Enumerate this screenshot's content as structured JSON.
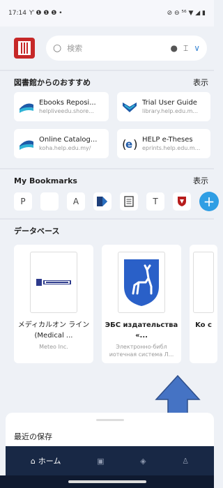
{
  "status": {
    "time": "17:14",
    "left_icons": "Ƴ ❶ ❶ ❶ •",
    "right_icons": "⊘ ⊖ ⁵⁶ ▼ ◢ ▮"
  },
  "search": {
    "placeholder": "検索"
  },
  "recommend": {
    "title": "図書館からのおすすめ",
    "more": "表示",
    "items": [
      {
        "title": "Ebooks Reposi...",
        "url": "helpliveedu.shore..."
      },
      {
        "title": "Trial User Guide",
        "url": "library.help.edu.m..."
      },
      {
        "title": "Online Catalog...",
        "url": "koha.help.edu.my/"
      },
      {
        "title": "HELP e-Theses",
        "url": "eprints.help.edu.m..."
      }
    ]
  },
  "bookmarks": {
    "title": "My Bookmarks",
    "more": "表示",
    "items": [
      "P",
      "",
      "A",
      "",
      "",
      "T",
      ""
    ]
  },
  "database": {
    "title": "データベース",
    "cards": [
      {
        "name": "メディカルオン ライン (Medical ...",
        "sub": "Meteo Inc."
      },
      {
        "name": "ЭБС издательства «...",
        "sub": "Электронно-библ иотечная система Л..."
      },
      {
        "name": "Ko c",
        "sub": ""
      }
    ]
  },
  "recent": {
    "title": "最近の保存"
  },
  "nav": {
    "home": "ホーム"
  },
  "colors": {
    "brand_red": "#c62828",
    "nav_bg": "#182845",
    "accent_blue": "#2f9ee4"
  }
}
